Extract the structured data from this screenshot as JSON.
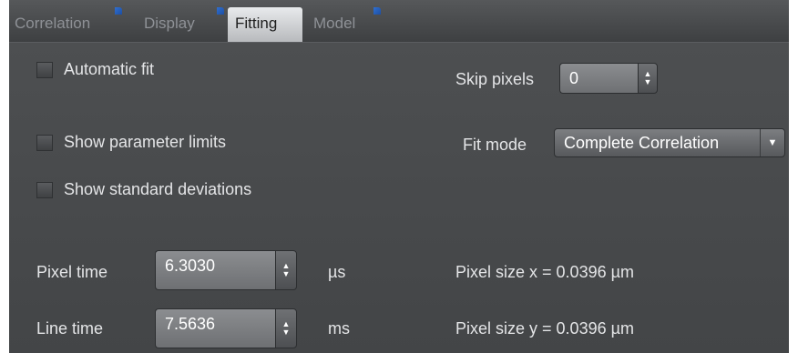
{
  "tabs": [
    {
      "label": "Correlation",
      "active": false
    },
    {
      "label": "Display",
      "active": false
    },
    {
      "label": "Fitting",
      "active": true
    },
    {
      "label": "Model",
      "active": false
    }
  ],
  "fitting": {
    "automatic_fit": {
      "label": "Automatic fit",
      "checked": false
    },
    "show_parameter_limits": {
      "label": "Show parameter limits",
      "checked": false
    },
    "show_standard_deviations": {
      "label": "Show standard deviations",
      "checked": false
    },
    "skip_pixels": {
      "label": "Skip pixels",
      "value": "0"
    },
    "fit_mode": {
      "label": "Fit mode",
      "value": "Complete Correlation"
    },
    "pixel_time": {
      "label": "Pixel time",
      "value": "6.3030",
      "unit": "µs"
    },
    "line_time": {
      "label": "Line time",
      "value": "7.5636",
      "unit": "ms"
    },
    "pixel_size_x": "Pixel size x = 0.0396 µm",
    "pixel_size_y": "Pixel size y = 0.0396 µm"
  },
  "icons": {
    "spin_up": "▲",
    "spin_down": "▼",
    "dropdown": "▼"
  }
}
